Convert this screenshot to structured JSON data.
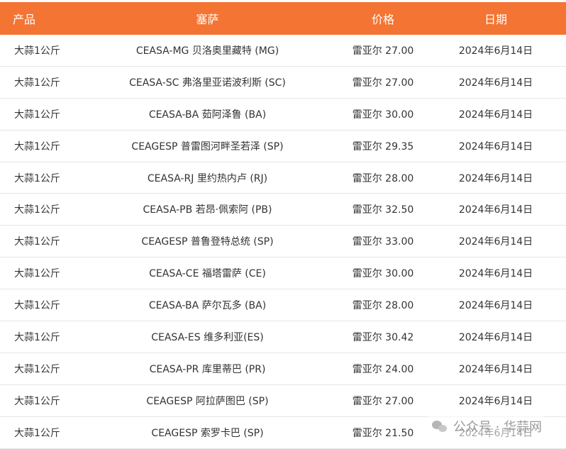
{
  "header": {
    "product": "产品",
    "ceasa": "塞萨",
    "price": "价格",
    "date": "日期"
  },
  "rows": [
    {
      "product": "大蒜1公斤",
      "ceasa": "CEASA-MG 贝洛奥里藏特 (MG)",
      "price": "雷亚尔 27.00",
      "date": "2024年6月14日"
    },
    {
      "product": "大蒜1公斤",
      "ceasa": "CEASA-SC 弗洛里亚诺波利斯 (SC)",
      "price": "雷亚尔 27.00",
      "date": "2024年6月14日"
    },
    {
      "product": "大蒜1公斤",
      "ceasa": "CEASA-BA 茹阿泽鲁 (BA)",
      "price": "雷亚尔 30.00",
      "date": "2024年6月14日"
    },
    {
      "product": "大蒜1公斤",
      "ceasa": "CEAGESP 普雷图河畔圣若泽 (SP)",
      "price": "雷亚尔 29.35",
      "date": "2024年6月14日"
    },
    {
      "product": "大蒜1公斤",
      "ceasa": "CEASA-RJ 里约热内卢 (RJ)",
      "price": "雷亚尔 28.00",
      "date": "2024年6月14日"
    },
    {
      "product": "大蒜1公斤",
      "ceasa": "CEASA-PB 若昂·佩索阿 (PB)",
      "price": "雷亚尔 32.50",
      "date": "2024年6月14日"
    },
    {
      "product": "大蒜1公斤",
      "ceasa": "CEAGESP 普鲁登特总统 (SP)",
      "price": "雷亚尔 33.00",
      "date": "2024年6月14日"
    },
    {
      "product": "大蒜1公斤",
      "ceasa": "CEASA-CE 福塔雷萨 (CE)",
      "price": "雷亚尔 30.00",
      "date": "2024年6月14日"
    },
    {
      "product": "大蒜1公斤",
      "ceasa": "CEASA-BA 萨尔瓦多 (BA)",
      "price": "雷亚尔 28.00",
      "date": "2024年6月14日"
    },
    {
      "product": "大蒜1公斤",
      "ceasa": "CEASA-ES 维多利亚(ES)",
      "price": "雷亚尔 30.42",
      "date": "2024年6月14日"
    },
    {
      "product": "大蒜1公斤",
      "ceasa": "CEASA-PR 库里蒂巴 (PR)",
      "price": "雷亚尔 24.00",
      "date": "2024年6月14日"
    },
    {
      "product": "大蒜1公斤",
      "ceasa": "CEAGESP 阿拉萨图巴 (SP)",
      "price": "雷亚尔 27.00",
      "date": "2024年6月14日"
    },
    {
      "product": "大蒜1公斤",
      "ceasa": "CEAGESP 索罗卡巴 (SP)",
      "price": "雷亚尔 21.50",
      "date": "2024年6月14日"
    }
  ],
  "watermark": {
    "text": "公众号 · 华蒜网"
  },
  "colors": {
    "header_bg": "#f47433",
    "header_text": "#ffffff",
    "body_text": "#333333",
    "divider": "#e6e6e6"
  }
}
